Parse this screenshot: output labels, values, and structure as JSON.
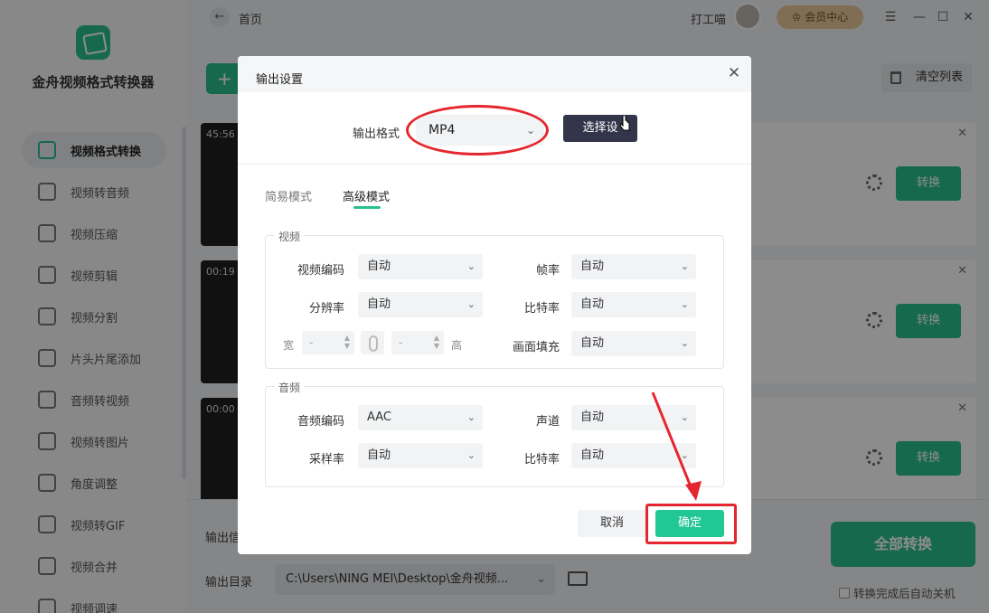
{
  "app": {
    "name": "金舟视频格式转换器",
    "nav": [
      {
        "label": "视频格式转换",
        "icon": "video-convert-icon",
        "active": true
      },
      {
        "label": "视频转音频",
        "icon": "audio-note-icon"
      },
      {
        "label": "视频压缩",
        "icon": "compress-icon"
      },
      {
        "label": "视频剪辑",
        "icon": "scissors-icon"
      },
      {
        "label": "视频分割",
        "icon": "split-icon"
      },
      {
        "label": "片头片尾添加",
        "icon": "film-strip-icon"
      },
      {
        "label": "音频转视频",
        "icon": "music-icon"
      },
      {
        "label": "视频转图片",
        "icon": "image-icon"
      },
      {
        "label": "角度调整",
        "icon": "rotate-icon"
      },
      {
        "label": "视频转GIF",
        "icon": "gif-icon"
      },
      {
        "label": "视频合并",
        "icon": "merge-icon"
      },
      {
        "label": "视频调速",
        "icon": "speed-icon"
      }
    ]
  },
  "topbar": {
    "back_icon": "←",
    "breadcrumb": "首页",
    "user_name": "打工喵",
    "vip_label": "会员中心",
    "window_controls": [
      "☰",
      "—",
      "☐",
      "✕"
    ]
  },
  "toolbar": {
    "add_label": "+",
    "clear_label": "清空列表"
  },
  "files": [
    {
      "duration": "45:56",
      "convert_label": "转换"
    },
    {
      "duration": "00:19",
      "convert_label": "转换"
    },
    {
      "duration": "00:00",
      "convert_label": "转换"
    }
  ],
  "bottom": {
    "output_info_label": "输出信",
    "output_dir_label": "输出目录",
    "output_dir_value": "C:\\Users\\NING MEI\\Desktop\\金舟视频...",
    "convert_all_label": "全部转换",
    "auto_shutdown_label": "转换完成后自动关机"
  },
  "dialog": {
    "title": "输出设置",
    "close_icon": "✕",
    "format_label": "输出格式",
    "format_value": "MP4",
    "choose_button": "选择设",
    "tabs": [
      {
        "label": "简易模式",
        "active": false
      },
      {
        "label": "高级模式",
        "active": true
      }
    ],
    "video": {
      "legend": "视频",
      "codec_label": "视频编码",
      "codec_value": "自动",
      "framerate_label": "帧率",
      "framerate_value": "自动",
      "resolution_label": "分辨率",
      "resolution_value": "自动",
      "bitrate_label": "比特率",
      "bitrate_value": "自动",
      "width_label": "宽",
      "width_value": "-",
      "height_label": "高",
      "height_value": "-",
      "fill_label": "画面填充",
      "fill_value": "自动"
    },
    "audio": {
      "legend": "音频",
      "codec_label": "音频编码",
      "codec_value": "AAC",
      "channel_label": "声道",
      "channel_value": "自动",
      "samplerate_label": "采样率",
      "samplerate_value": "自动",
      "bitrate_label": "比特率",
      "bitrate_value": "自动"
    },
    "cancel_label": "取消",
    "ok_label": "确定"
  },
  "colors": {
    "accent": "#2bbf8f",
    "annotation": "#e5262e",
    "dark_button": "#33354a"
  }
}
